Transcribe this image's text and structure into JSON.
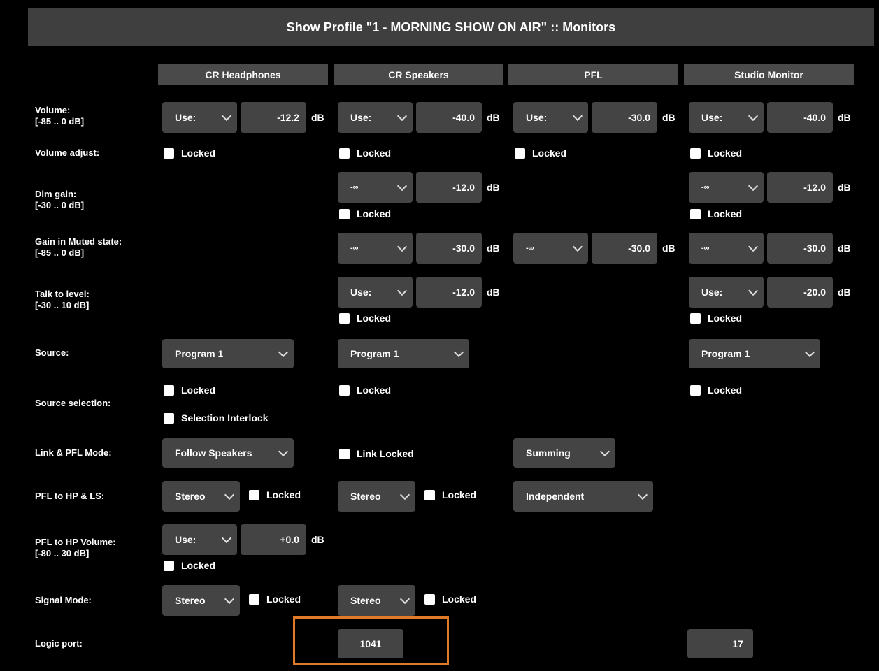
{
  "title": "Show Profile \"1 - MORNING SHOW ON AIR\" :: Monitors",
  "columns": [
    "CR Headphones",
    "CR Speakers",
    "PFL",
    "Studio Monitor"
  ],
  "rows": {
    "volume": [
      "Volume:",
      "[-85 .. 0 dB]"
    ],
    "volume_adjust": "Volume adjust:",
    "dim_gain": [
      "Dim gain:",
      "[-30 .. 0 dB]"
    ],
    "muted_gain": [
      "Gain in Muted state:",
      "[-85 .. 0 dB]"
    ],
    "talk_level": [
      "Talk to level:",
      "[-30 .. 10 dB]"
    ],
    "source": "Source:",
    "source_selection": "Source selection:",
    "link_pfl_mode": "Link & PFL Mode:",
    "pfl_hp_ls": "PFL to HP & LS:",
    "pfl_hp_volume": [
      "PFL to HP Volume:",
      "[-80 .. 30 dB]"
    ],
    "signal_mode": "Signal Mode:",
    "logic_port": "Logic port:"
  },
  "unit": "dB",
  "locked": "Locked",
  "use": "Use:",
  "neg_inf": "-∞",
  "volume_values": [
    "-12.2",
    "-40.0",
    "-30.0",
    "-40.0"
  ],
  "dim_values": {
    "speakers": "-12.0",
    "studio": "-12.0"
  },
  "muted_values": {
    "speakers": "-30.0",
    "pfl": "-30.0",
    "studio": "-30.0"
  },
  "talk_values": {
    "speakers": "-12.0",
    "studio": "-20.0"
  },
  "source_value": "Program 1",
  "selection_interlock": "Selection Interlock",
  "link_mode": {
    "headphones": "Follow Speakers",
    "speakers_lock": "Link Locked",
    "pfl": "Summing"
  },
  "pfl_hp_ls": {
    "stereo": "Stereo",
    "pfl": "Independent"
  },
  "pfl_hp_volume_value": "+0.0",
  "signal_mode_value": "Stereo",
  "logic_port": {
    "speakers": "1041",
    "studio": "17"
  },
  "colors": {
    "background": "#000000",
    "control": "#444444",
    "highlight": "#e07a27"
  }
}
